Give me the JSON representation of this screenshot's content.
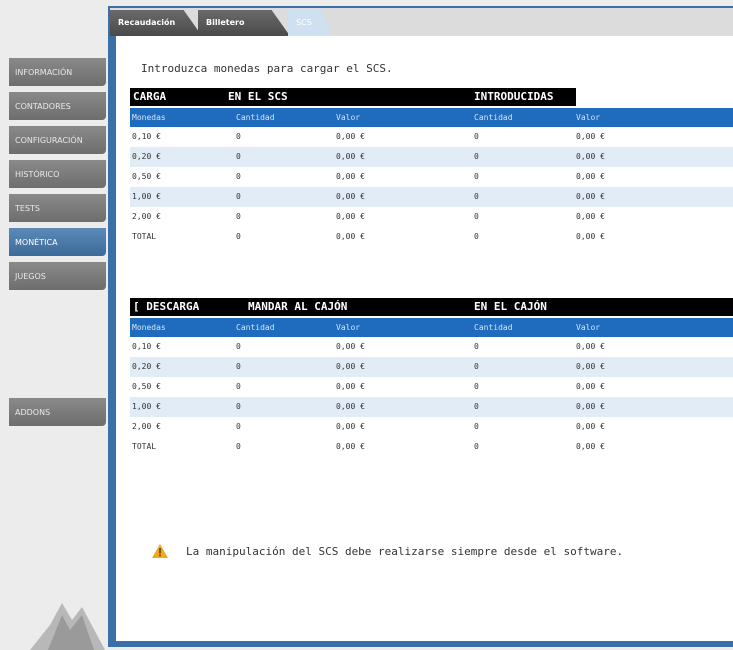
{
  "tabs": [
    {
      "label": "Recaudación"
    },
    {
      "label": "Billetero"
    },
    {
      "label": "SCS"
    }
  ],
  "sidebar": {
    "items": [
      {
        "label": "INFORMACIÓN"
      },
      {
        "label": "CONTADORES"
      },
      {
        "label": "CONFIGURACIÓN"
      },
      {
        "label": "HISTÓRICO"
      },
      {
        "label": "TESTS"
      },
      {
        "label": "MONÉTICA"
      },
      {
        "label": "JUEGOS"
      },
      {
        "label": "ADDONS"
      }
    ],
    "active": "MONÉTICA"
  },
  "main": {
    "intro": "Introduzca monedas para cargar el SCS.",
    "carga": {
      "banner": {
        "title": "CARGA",
        "mid": "EN EL SCS",
        "right": "INTRODUCIDAS"
      },
      "headers": [
        "Monedas",
        "Cantidad",
        "Valor",
        "Cantidad",
        "Valor"
      ],
      "rows": [
        [
          "0,10 €",
          "0",
          "0,00 €",
          "0",
          "0,00 €"
        ],
        [
          "0,20 €",
          "0",
          "0,00 €",
          "0",
          "0,00 €"
        ],
        [
          "0,50 €",
          "0",
          "0,00 €",
          "0",
          "0,00 €"
        ],
        [
          "1,00 €",
          "0",
          "0,00 €",
          "0",
          "0,00 €"
        ],
        [
          "2,00 €",
          "0",
          "0,00 €",
          "0",
          "0,00 €"
        ],
        [
          "TOTAL",
          "0",
          "0,00 €",
          "0",
          "0,00 €"
        ]
      ]
    },
    "descarga": {
      "banner": {
        "title": "[ DESCARGA",
        "mid": "MANDAR AL CAJÓN",
        "right": "EN EL CAJÓN"
      },
      "headers": [
        "Monedas",
        "Cantidad",
        "Valor",
        "Cantidad",
        "Valor"
      ],
      "rows": [
        [
          "0,10 €",
          "0",
          "0,00 €",
          "0",
          "0,00 €"
        ],
        [
          "0,20 €",
          "0",
          "0,00 €",
          "0",
          "0,00 €"
        ],
        [
          "0,50 €",
          "0",
          "0,00 €",
          "0",
          "0,00 €"
        ],
        [
          "1,00 €",
          "0",
          "0,00 €",
          "0",
          "0,00 €"
        ],
        [
          "2,00 €",
          "0",
          "0,00 €",
          "0",
          "0,00 €"
        ],
        [
          "TOTAL",
          "0",
          "0,00 €",
          "0",
          "0,00 €"
        ]
      ]
    },
    "warning": "La manipulación del SCS debe realizarse siempre desde el software."
  },
  "colors": {
    "accent": "#1f6bbd",
    "frame": "#3a6fa8",
    "row_alt": "#e2ecf7",
    "sidebar_button": "#7a7a7a",
    "warning": "#f0a81e"
  },
  "icons": {
    "warning": "warning-triangle-icon",
    "logo": "brand-logo"
  }
}
